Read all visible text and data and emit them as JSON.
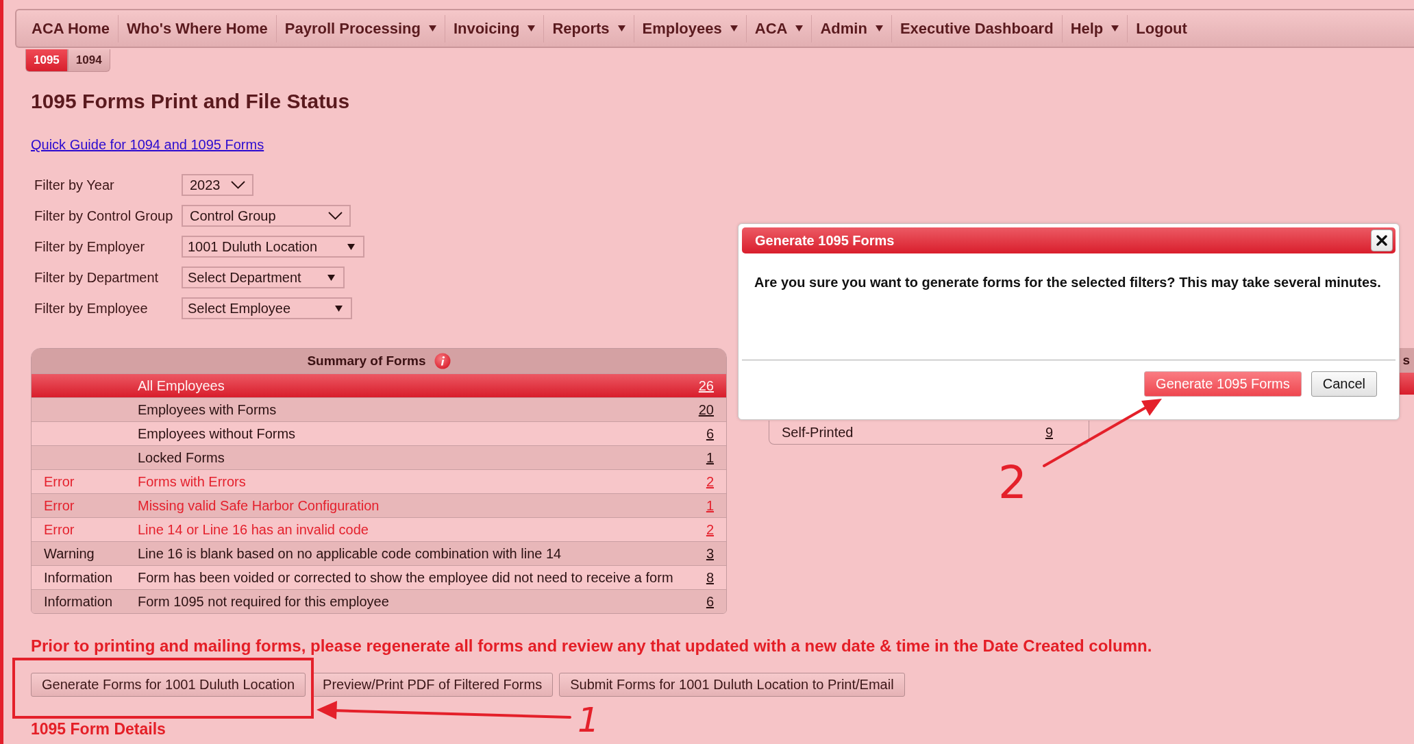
{
  "nav": [
    {
      "label": "ACA Home",
      "has_menu": false
    },
    {
      "label": "Who's Where Home",
      "has_menu": false
    },
    {
      "label": "Payroll Processing",
      "has_menu": true
    },
    {
      "label": "Invoicing",
      "has_menu": true
    },
    {
      "label": "Reports",
      "has_menu": true
    },
    {
      "label": "Employees",
      "has_menu": true
    },
    {
      "label": "ACA",
      "has_menu": true
    },
    {
      "label": "Admin",
      "has_menu": true
    },
    {
      "label": "Executive Dashboard",
      "has_menu": false
    },
    {
      "label": "Help",
      "has_menu": true
    },
    {
      "label": "Logout",
      "has_menu": false
    }
  ],
  "subtabs": [
    {
      "label": "1095",
      "selected": true
    },
    {
      "label": "1094",
      "selected": false
    }
  ],
  "title": "1095 Forms Print and File Status",
  "guide_link": "Quick Guide for 1094 and 1095 Forms",
  "filters": [
    {
      "label": "Filter by Year",
      "value": "2023",
      "kind": "chevron"
    },
    {
      "label": "Filter by Control Group",
      "value": "Control Group",
      "kind": "chevron"
    },
    {
      "label": "Filter by Employer",
      "value": "1001 Duluth Location",
      "kind": "caret"
    },
    {
      "label": "Filter by Department",
      "value": "Select Department",
      "kind": "caret"
    },
    {
      "label": "Filter by Employee",
      "value": "Select Employee",
      "kind": "caret"
    }
  ],
  "summary": {
    "title": "Summary of Forms",
    "rows": [
      {
        "label": "All Employees",
        "count": "26",
        "kind": "normal",
        "selected": true
      },
      {
        "label": "Employees with Forms",
        "count": "20",
        "kind": "normal",
        "selected": false
      },
      {
        "label": "Employees without Forms",
        "count": "6",
        "kind": "normal",
        "selected": false
      },
      {
        "label": "Locked Forms",
        "count": "1",
        "kind": "normal",
        "selected": false
      },
      {
        "category": "Error",
        "label": "Forms with Errors",
        "count": "2",
        "kind": "error",
        "selected": false
      },
      {
        "category": "Error",
        "label": "Missing valid Safe Harbor Configuration",
        "count": "1",
        "kind": "error",
        "selected": false
      },
      {
        "category": "Error",
        "label": "Line 14 or Line 16 has an invalid code",
        "count": "2",
        "kind": "error",
        "selected": false
      },
      {
        "category": "Warning",
        "label": "Line 16 is blank based on no applicable code combination with line 14",
        "count": "3",
        "kind": "warning",
        "selected": false
      },
      {
        "category": "Information",
        "label": "Form has been voided or corrected to show the employee did not need to receive a form",
        "count": "8",
        "kind": "info",
        "selected": false
      },
      {
        "category": "Information",
        "label": "Form 1095 not required for this employee",
        "count": "6",
        "kind": "info",
        "selected": false
      }
    ]
  },
  "status_panel": {
    "rows": [
      {
        "label": "Self-Printed",
        "count": "9"
      }
    ]
  },
  "side_panel": {
    "header_text": "s"
  },
  "notice": "Prior to printing and mailing forms, please regenerate all forms and review any that updated with a new date & time in the Date Created column.",
  "actions": [
    "Generate Forms for 1001 Duluth Location",
    "Preview/Print PDF of Filtered Forms",
    "Submit Forms for 1001 Duluth Location to Print/Email"
  ],
  "details_title": "1095 Form Details",
  "dialog": {
    "title": "Generate 1095 Forms",
    "message": "Are you sure you want to generate forms for the selected filters? This may take several minutes.",
    "buttons": [
      {
        "label": "Generate 1095 Forms",
        "kind": "primary"
      },
      {
        "label": "Cancel",
        "kind": "secondary"
      }
    ]
  },
  "annotations": [
    {
      "label": "1"
    },
    {
      "label": "2"
    }
  ]
}
